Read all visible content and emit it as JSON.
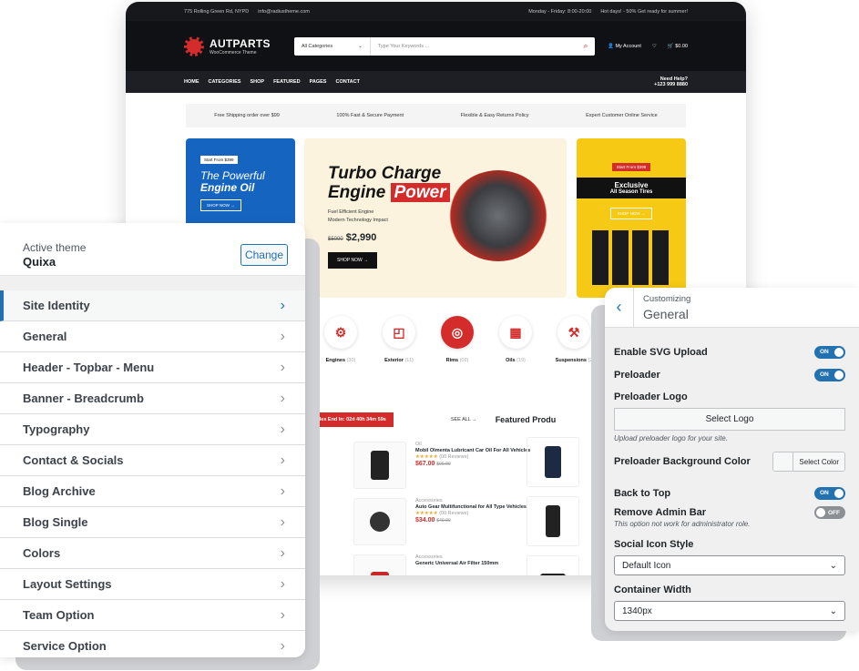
{
  "site": {
    "topbar": {
      "address": "775 Rolling Green Rd, NYPD",
      "email": "info@radiustheme.com",
      "hours": "Monday - Friday: 8:00-20:00",
      "promo": "Hot days! - 50% Get ready for summer!"
    },
    "logo": {
      "name": "AUTPARTS",
      "tagline": "WooCommerce Theme"
    },
    "search": {
      "category": "All Categories",
      "placeholder": "Type Your Keywords ..."
    },
    "account": {
      "label": "My Account",
      "cart_total": "$0.00"
    },
    "nav": [
      "HOME",
      "CATEGORIES",
      "SHOP",
      "FEATURED",
      "PAGES",
      "CONTACT"
    ],
    "help": {
      "label": "Need Help?",
      "phone": "+123 999 8880"
    },
    "features": [
      "Free Shipping order over $99",
      "100% Fast & Secure Payment",
      "Flexible & Easy Returns Policy",
      "Expert Customer Online Service"
    ],
    "banner1": {
      "tag": "Start From $399",
      "line1": "The Powerful",
      "line2": "Engine Oil",
      "button": "SHOP NOW →"
    },
    "banner2": {
      "line1": "Turbo Charge",
      "line2a": "Engine",
      "line2b": "Power",
      "bullet1": "Fuel Efficient Engine",
      "bullet2": "Modern Technology Impact",
      "old_price": "$5000",
      "price": "$2,990",
      "button": "SHOP NOW →"
    },
    "banner3": {
      "tag": "Start From $399",
      "title": "Exclusive",
      "subtitle": "All Season Tires",
      "button": "SHOP NOW →"
    },
    "categories": [
      {
        "name": "Engines",
        "count": "(30)"
      },
      {
        "name": "Exterior",
        "count": "(11)"
      },
      {
        "name": "Rims",
        "count": "(09)"
      },
      {
        "name": "Oils",
        "count": "(19)"
      },
      {
        "name": "Suspensions",
        "count": "(2"
      }
    ],
    "sales": {
      "label": "Sales End In:",
      "days": "02",
      "hrs": "40",
      "min": "34",
      "sec": "59",
      "see_all": "SEE ALL",
      "featured": "Featured Produ"
    },
    "products": [
      {
        "cat": "Oil",
        "name": "Mobil Olmenta Lubricant Car Oil For All Vehicles",
        "stars": "★★★★★",
        "reviews": "(00 Reviews)",
        "price": "$67.00",
        "old": "$90.00"
      },
      {
        "cat": "Accessories",
        "name": "Auto Gear Multifunctional for All Type Vehicles",
        "stars": "★★★★★",
        "reviews": "(00 Reviews)",
        "price": "$34.00",
        "old": "$40.00"
      },
      {
        "cat": "Accessories",
        "name": "Generic Universal Air Filter 150mm",
        "stars": "",
        "reviews": "",
        "price": "",
        "old": ""
      }
    ]
  },
  "left_panel": {
    "active_theme_label": "Active theme",
    "theme_name": "Quixa",
    "change_button": "Change",
    "items": [
      "Site Identity",
      "General",
      "Header - Topbar - Menu",
      "Banner - Breadcrumb",
      "Typography",
      "Contact & Socials",
      "Blog Archive",
      "Blog Single",
      "Colors",
      "Layout Settings",
      "Team Option",
      "Service Option"
    ]
  },
  "right_panel": {
    "breadcrumb": "Customizing",
    "title": "General",
    "svg_upload": {
      "label": "Enable SVG Upload",
      "state": "ON"
    },
    "preloader": {
      "label": "Preloader",
      "state": "ON"
    },
    "preloader_logo": {
      "label": "Preloader Logo",
      "button": "Select Logo",
      "desc": "Upload preloader logo for your site."
    },
    "preloader_bg": {
      "label": "Preloader Background Color",
      "button": "Select Color"
    },
    "back_to_top": {
      "label": "Back to Top",
      "state": "ON"
    },
    "admin_bar": {
      "label": "Remove Admin Bar",
      "state": "OFF",
      "desc": "This option not work for administrator role."
    },
    "social_icon": {
      "label": "Social Icon Style",
      "value": "Default Icon"
    },
    "container": {
      "label": "Container Width",
      "value": "1340px"
    }
  },
  "colors": {
    "accent": "#d42b2b",
    "wp_blue": "#2271b1",
    "banner_blue": "#1565c0",
    "banner_yellow": "#f5c914"
  }
}
